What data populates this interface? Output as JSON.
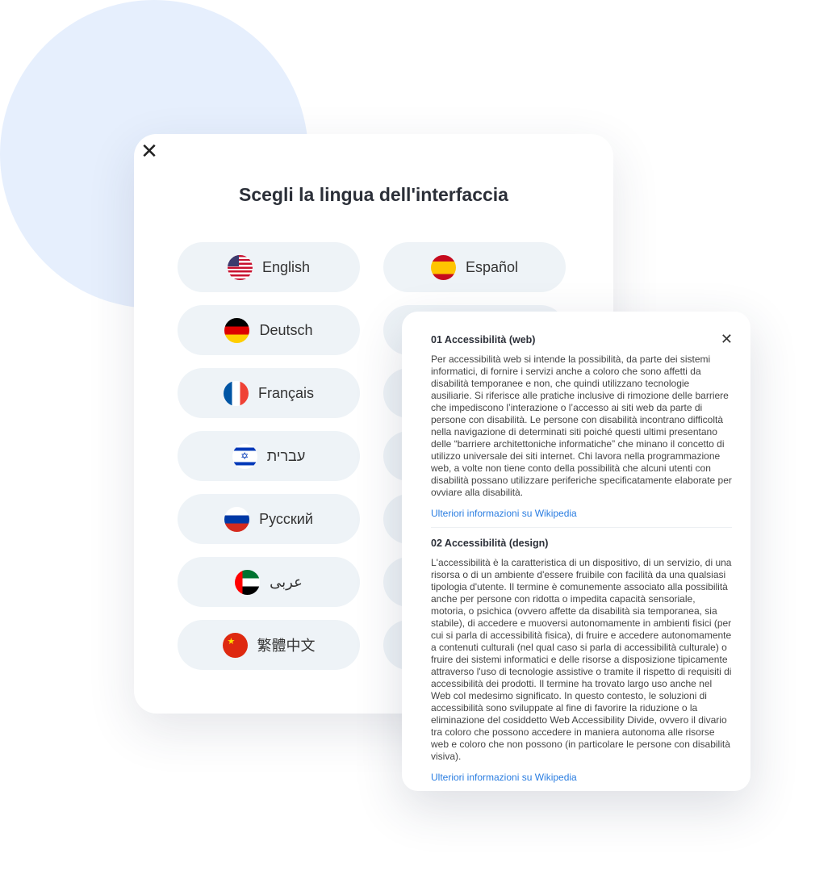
{
  "dialog": {
    "title": "Scegli la lingua dell'interfaccia",
    "close_icon": "close-icon",
    "languages": [
      {
        "label": "English",
        "flag": "us"
      },
      {
        "label": "Español",
        "flag": "es"
      },
      {
        "label": "Deutsch",
        "flag": "de"
      },
      {
        "label": "",
        "flag": ""
      },
      {
        "label": "Français",
        "flag": "fr"
      },
      {
        "label": "",
        "flag": ""
      },
      {
        "label": "עברית",
        "flag": "il"
      },
      {
        "label": "",
        "flag": ""
      },
      {
        "label": "Русский",
        "flag": "ru"
      },
      {
        "label": "",
        "flag": ""
      },
      {
        "label": "عربى",
        "flag": "ae"
      },
      {
        "label": "",
        "flag": ""
      },
      {
        "label": "繁體中文",
        "flag": "cn"
      },
      {
        "label": "",
        "flag": ""
      }
    ]
  },
  "popup": {
    "sections": [
      {
        "title": "01 Accessibilità (web)",
        "body": "Per accessibilità web si intende la possibilità, da parte dei sistemi informatici, di fornire i servizi anche a coloro che sono affetti da disabilità temporanee e non, che quindi utilizzano tecnologie ausiliarie. Si riferisce alle pratiche inclusive di rimozione delle barriere che impediscono l’interazione o l’accesso ai siti web da parte di persone con disabilità. Le persone con disabilità incontrano difficoltà nella navigazione di determinati siti poiché questi ultimi presentano delle “barriere architettoniche informatiche” che minano il concetto di utilizzo universale dei siti internet. Chi lavora nella programmazione web, a volte non tiene conto della possibilità che alcuni utenti con disabilità possano utilizzare periferiche specificatamente elaborate per ovviare alla disabilità.",
        "link": "Ulteriori informazioni su Wikipedia"
      },
      {
        "title": "02 Accessibilità (design)",
        "body": "L'accessibilità è la caratteristica di un dispositivo, di un servizio, di una risorsa o di un ambiente d'essere fruibile con facilità da una qualsiasi tipologia d'utente. Il termine è comunemente associato alla possibilità anche per persone con ridotta o impedita capacità sensoriale, motoria, o psichica (ovvero affette da disabilità sia temporanea, sia stabile), di accedere e muoversi autonomamente in ambienti fisici (per cui si parla di accessibilità fisica), di fruire e accedere autonomamente a contenuti culturali (nel qual caso si parla di accessibilità culturale) o fruire dei sistemi informatici e delle risorse a disposizione tipicamente attraverso l'uso di tecnologie assistive o tramite il rispetto di requisiti di accessibilità dei prodotti. Il termine ha trovato largo uso anche nel Web col medesimo significato. In questo contesto, le soluzioni di accessibilità sono sviluppate al fine di favorire la riduzione o la eliminazione del cosiddetto Web Accessibility Divide, ovvero il divario tra coloro che possono accedere in maniera autonoma alle risorse web e coloro che non possono (in particolare le persone con disabilità visiva).",
        "link": "Ulteriori informazioni su Wikipedia"
      }
    ]
  },
  "colors": {
    "background_circle": "#e6effd",
    "link": "#2a7de1",
    "button_bg": "#eef3f7"
  }
}
